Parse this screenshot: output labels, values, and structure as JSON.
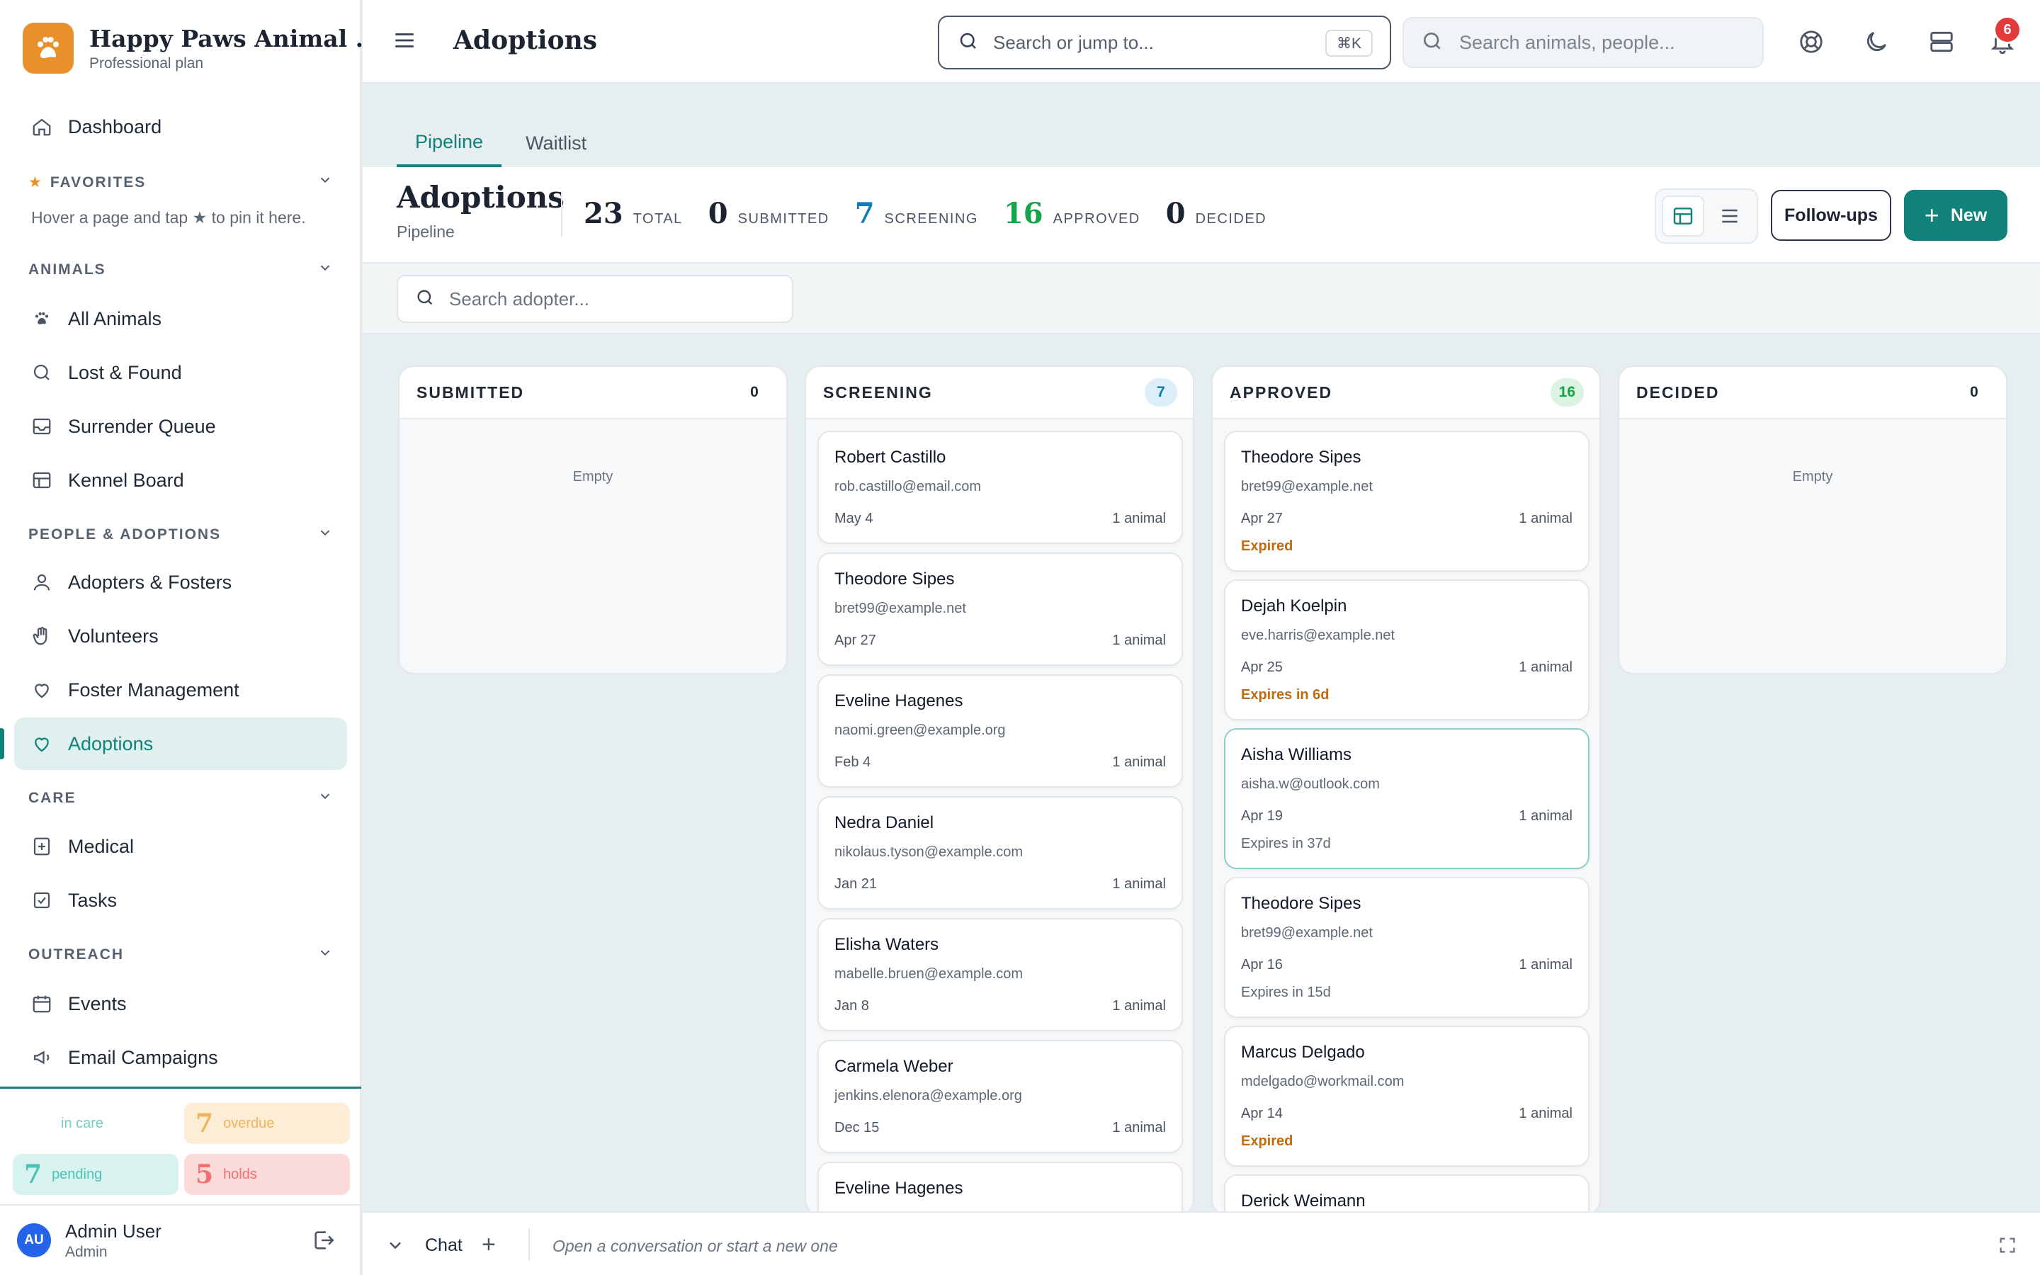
{
  "brand": {
    "name": "Happy Paws Animal ...",
    "plan": "Professional plan"
  },
  "sidebar": {
    "dashboard": "Dashboard",
    "favorites": {
      "title": "FAVORITES",
      "hint": "Hover a page and tap ★ to pin it here."
    },
    "animals": {
      "title": "ANIMALS",
      "items": [
        "All Animals",
        "Lost & Found",
        "Surrender Queue",
        "Kennel Board"
      ]
    },
    "people": {
      "title": "PEOPLE & ADOPTIONS",
      "items": [
        "Adopters & Fosters",
        "Volunteers",
        "Foster Management",
        "Adoptions"
      ]
    },
    "care": {
      "title": "CARE",
      "items": [
        "Medical",
        "Tasks"
      ]
    },
    "outreach": {
      "title": "OUTREACH",
      "items": [
        "Events",
        "Email Campaigns"
      ]
    },
    "stats": {
      "in_care": {
        "label": "in care"
      },
      "overdue": {
        "num": "7",
        "label": "overdue"
      },
      "pending": {
        "num": "7",
        "label": "pending"
      },
      "holds": {
        "num": "5",
        "label": "holds"
      }
    },
    "user": {
      "initials": "AU",
      "name": "Admin User",
      "role": "Admin"
    }
  },
  "topbar": {
    "title": "Adoptions",
    "jump_placeholder": "Search or jump to...",
    "shortcut": "⌘K",
    "search_placeholder": "Search animals, people...",
    "notifications": "6"
  },
  "tabs": [
    "Pipeline",
    "Waitlist"
  ],
  "header": {
    "title": "Adoptions",
    "subtitle": "Pipeline",
    "counts": [
      {
        "num": "23",
        "label": "TOTAL",
        "color": "#1b2430"
      },
      {
        "num": "0",
        "label": "SUBMITTED",
        "color": "#1b2430"
      },
      {
        "num": "7",
        "label": "SCREENING",
        "color": "#0e7ab8"
      },
      {
        "num": "16",
        "label": "APPROVED",
        "color": "#16a34a"
      },
      {
        "num": "0",
        "label": "DECIDED",
        "color": "#1b2430"
      }
    ],
    "followups": "Follow-ups",
    "new": "New"
  },
  "filter": {
    "placeholder": "Search adopter..."
  },
  "board": {
    "empty": "Empty",
    "columns": [
      {
        "title": "SUBMITTED",
        "count": "0"
      },
      {
        "title": "SCREENING",
        "count": "7"
      },
      {
        "title": "APPROVED",
        "count": "16"
      },
      {
        "title": "DECIDED",
        "count": "0"
      }
    ],
    "screening": [
      {
        "name": "Robert Castillo",
        "email": "rob.castillo@email.com",
        "date": "May 4",
        "animals": "1 animal"
      },
      {
        "name": "Theodore Sipes",
        "email": "bret99@example.net",
        "date": "Apr 27",
        "animals": "1 animal"
      },
      {
        "name": "Eveline Hagenes",
        "email": "naomi.green@example.org",
        "date": "Feb 4",
        "animals": "1 animal"
      },
      {
        "name": "Nedra Daniel",
        "email": "nikolaus.tyson@example.com",
        "date": "Jan 21",
        "animals": "1 animal"
      },
      {
        "name": "Elisha Waters",
        "email": "mabelle.bruen@example.com",
        "date": "Jan 8",
        "animals": "1 animal"
      },
      {
        "name": "Carmela Weber",
        "email": "jenkins.elenora@example.org",
        "date": "Dec 15",
        "animals": "1 animal"
      },
      {
        "name": "Eveline Hagenes"
      }
    ],
    "approved": [
      {
        "name": "Theodore Sipes",
        "email": "bret99@example.net",
        "date": "Apr 27",
        "animals": "1 animal",
        "status": "Expired"
      },
      {
        "name": "Dejah Koelpin",
        "email": "eve.harris@example.net",
        "date": "Apr 25",
        "animals": "1 animal",
        "status": "Expires in 6d"
      },
      {
        "name": "Aisha Williams",
        "email": "aisha.w@outlook.com",
        "date": "Apr 19",
        "animals": "1 animal",
        "status": "Expires in 37d"
      },
      {
        "name": "Theodore Sipes",
        "email": "bret99@example.net",
        "date": "Apr 16",
        "animals": "1 animal",
        "status": "Expires in 15d"
      },
      {
        "name": "Marcus Delgado",
        "email": "mdelgado@workmail.com",
        "date": "Apr 14",
        "animals": "1 animal",
        "status": "Expired"
      },
      {
        "name": "Derick Weimann"
      }
    ]
  },
  "chat": {
    "label": "Chat",
    "hint": "Open a conversation or start a new one"
  },
  "colors": {
    "accent": "#11827a",
    "warning": "#c26b0c",
    "badge": "#e23b3b"
  }
}
